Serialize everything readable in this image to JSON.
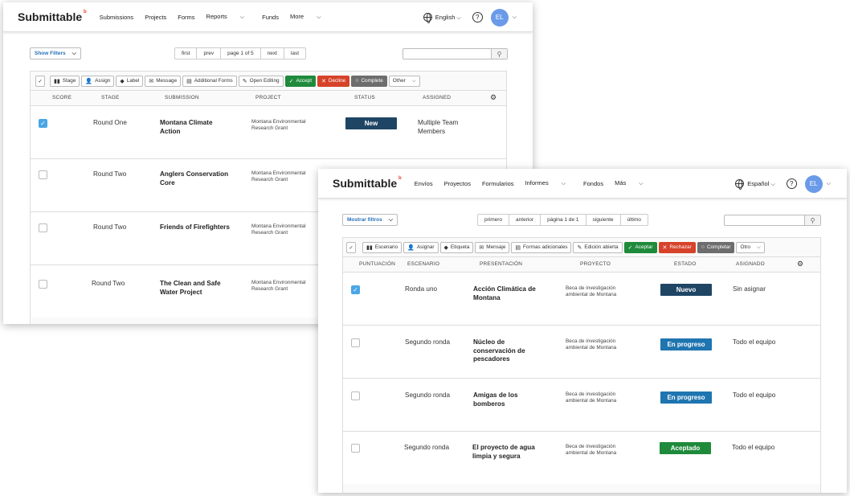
{
  "en": {
    "logo": "Submittable",
    "nav": [
      "Submissions",
      "Projects",
      "Forms",
      "Reports",
      "Funds",
      "More"
    ],
    "language": "English",
    "help": "?",
    "avatar": "EL",
    "show_filters": "Show Filters",
    "pager": [
      "first",
      "prev",
      "page 1 of 5",
      "next",
      "last"
    ],
    "toolbar": {
      "stage": "Stage",
      "assign": "Assign",
      "label": "Label",
      "message": "Message",
      "additional_forms": "Additional Forms",
      "open_editing": "Open Editing",
      "accept": "Accept",
      "decline": "Decline",
      "complete": "Complete",
      "other": "Other"
    },
    "columns": [
      "SCORE",
      "STAGE",
      "SUBMISSION",
      "PROJECT",
      "STATUS",
      "ASSIGNED"
    ],
    "rows": [
      {
        "stage": "Round One",
        "submission": "Montana Climate Action",
        "project": "Montana Environmental Research Grant",
        "status": "New",
        "assigned": "Multiple Team Members",
        "checked": true
      },
      {
        "stage": "Round Two",
        "submission": "Anglers Conservation Core",
        "project": "Montana Environmental Research Grant",
        "status": "",
        "assigned": "",
        "checked": false
      },
      {
        "stage": "Round Two",
        "submission": "Friends of Firefighters",
        "project": "Montana Environmental Research Grant",
        "status": "",
        "assigned": "",
        "checked": false
      },
      {
        "stage": "Round Two",
        "submission": "The Clean and Safe Water Project",
        "project": "Montana Environmental Research Grant",
        "status": "",
        "assigned": "",
        "checked": false
      }
    ]
  },
  "es": {
    "logo": "Submittable",
    "nav": [
      "Envíos",
      "Proyectos",
      "Formularios",
      "Informes",
      "Fondos",
      "Más"
    ],
    "language": "Español",
    "help": "?",
    "avatar": "EL",
    "show_filters": "Mostrar filtros",
    "pager": [
      "primero",
      "anterior",
      "página 1 de 1",
      "siguiente",
      "último"
    ],
    "toolbar": {
      "stage": "Escenario",
      "assign": "Asignar",
      "label": "Etiqueta",
      "message": "Mensaje",
      "additional_forms": "Formas adicionales",
      "open_editing": "Edición abierta",
      "accept": "Aceptar",
      "decline": "Rechazar",
      "complete": "Completar",
      "other": "Otro"
    },
    "columns": [
      "PUNTUACIÓN",
      "ESCENARIO",
      "PRESENTACIÓN",
      "PROYECTO",
      "ESTADO",
      "ASIGNADO"
    ],
    "rows": [
      {
        "stage": "Ronda uno",
        "submission": "Acción Climática de Montana",
        "project": "Beca de investigación ambiental de Montana",
        "status": "Nuevo",
        "assigned": "Sin asignar",
        "checked": true
      },
      {
        "stage": "Segundo ronda",
        "submission": "Núcleo de conservación de pescadores",
        "project": "Beca de investigación ambiental de Montana",
        "status": "En progreso",
        "assigned": "Todo el equipo",
        "checked": false
      },
      {
        "stage": "Segundo ronda",
        "submission": "Amigas de los bomberos",
        "project": "Beca de investigación ambiental de Montana",
        "status": "En progreso",
        "assigned": "Todo el equipo",
        "checked": false
      },
      {
        "stage": "Segundo ronda",
        "submission": "El proyecto de agua limpia y segura",
        "project": "Beca de investigación ambiental de Montana",
        "status": "Aceptado",
        "assigned": "Todo el equipo",
        "checked": false
      }
    ]
  },
  "colors": {
    "new": "#1f4564",
    "in_progress": "#1f75b0",
    "accepted": "#1f8a3b",
    "accept_btn": "#1f8a3b",
    "decline_btn": "#d6422a",
    "complete_btn": "#6d6d6d",
    "avatar": "#6a9ae8",
    "logo_mark": "#e8452c"
  }
}
